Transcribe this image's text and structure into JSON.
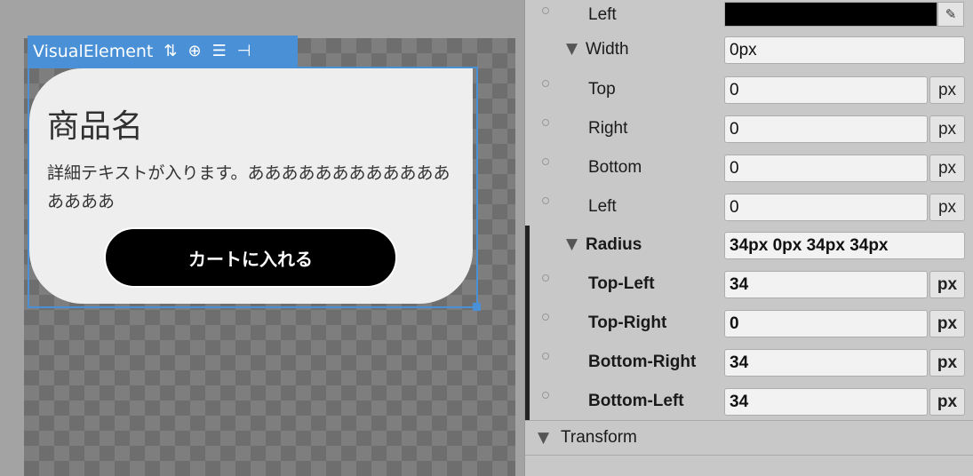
{
  "canvas": {
    "toolbar_label": "VisualElement",
    "toolbar_icons": [
      "sort-icon",
      "align-center-icon",
      "align-middle-icon",
      "align-end-icon"
    ],
    "card": {
      "title": "商品名",
      "description": "詳細テキストが入ります。ああああああああああああああああ",
      "button_label": "カートに入れる"
    }
  },
  "inspector": {
    "color_left_label": "Left",
    "color_left_value": "#000000",
    "width_label": "Width",
    "width_value": "0px",
    "width_top": {
      "label": "Top",
      "value": "0",
      "unit": "px"
    },
    "width_right": {
      "label": "Right",
      "value": "0",
      "unit": "px"
    },
    "width_bottom": {
      "label": "Bottom",
      "value": "0",
      "unit": "px"
    },
    "width_left": {
      "label": "Left",
      "value": "0",
      "unit": "px"
    },
    "radius_label": "Radius",
    "radius_value": "34px 0px 34px 34px",
    "radius_tl": {
      "label": "Top-Left",
      "value": "34",
      "unit": "px"
    },
    "radius_tr": {
      "label": "Top-Right",
      "value": "0",
      "unit": "px"
    },
    "radius_br": {
      "label": "Bottom-Right",
      "value": "34",
      "unit": "px"
    },
    "radius_bl": {
      "label": "Bottom-Left",
      "value": "34",
      "unit": "px"
    },
    "transform_label": "Transform"
  }
}
